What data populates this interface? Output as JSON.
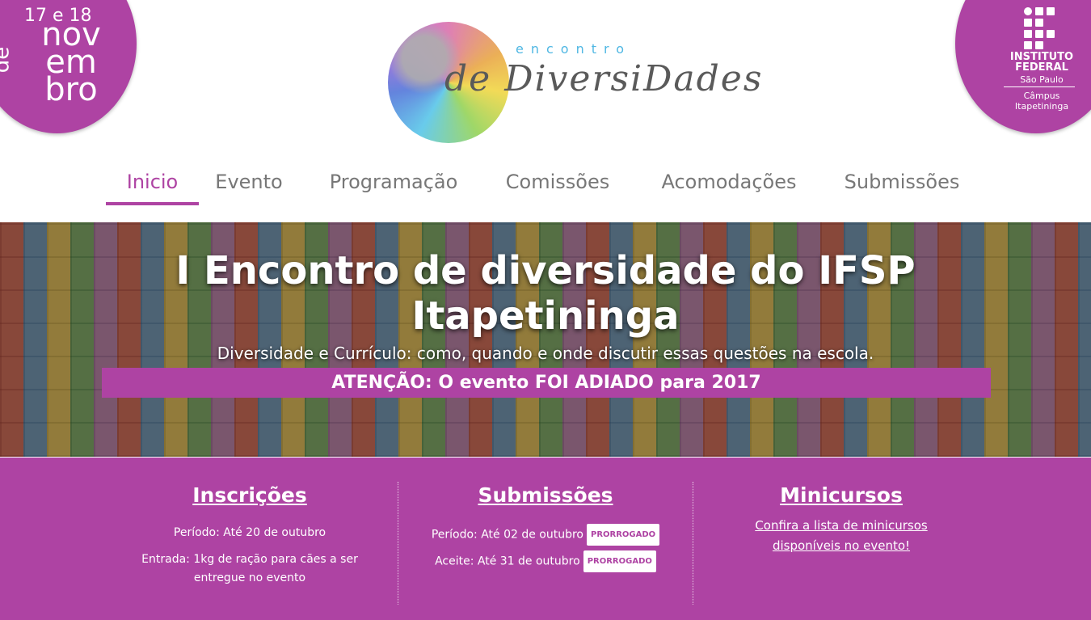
{
  "date": {
    "days": "17 e 18",
    "month_lines": [
      "nov",
      "em",
      "bro"
    ],
    "de": "de"
  },
  "institution": {
    "line1": "INSTITUTO",
    "line2": "FEDERAL",
    "line3": "São Paulo",
    "campus1": "Câmpus",
    "campus2": "Itapetininga"
  },
  "logo": {
    "encontro": "encontro",
    "diversidades": "de DiversiDades"
  },
  "nav": {
    "items": [
      "Inicio",
      "Evento",
      "Programação",
      "Comissões",
      "Acomodações",
      "Submissões"
    ],
    "active": "Inicio"
  },
  "hero": {
    "title_line1": "I Encontro de diversidade do IFSP",
    "title_line2": "Itapetininga",
    "subtitle": "Diversidade e Currículo: como, quando e onde discutir essas questões na escola.",
    "banner": "ATENÇÃO: O evento FOI ADIADO para 2017"
  },
  "info": {
    "inscricoes": {
      "title": "Inscrições",
      "periodo": "Período: Até 20 de outubro",
      "entrada_line1": "Entrada: 1kg de ração para cães a ser",
      "entrada_line2": "entregue no evento"
    },
    "submissoes": {
      "title": "Submissões",
      "periodo": "Período: Até 02 de outubro",
      "periodo_badge": "PRORROGADO",
      "aceite": "Aceite: Até 31 de outubro",
      "aceite_badge": "PRORROGADO"
    },
    "minicursos": {
      "title": "Minicursos",
      "link_line1": "Confira a lista de minicursos",
      "link_line2": "disponíveis no evento!"
    }
  },
  "colors": {
    "brand": "#ae43a3",
    "nav_text": "#777777"
  }
}
